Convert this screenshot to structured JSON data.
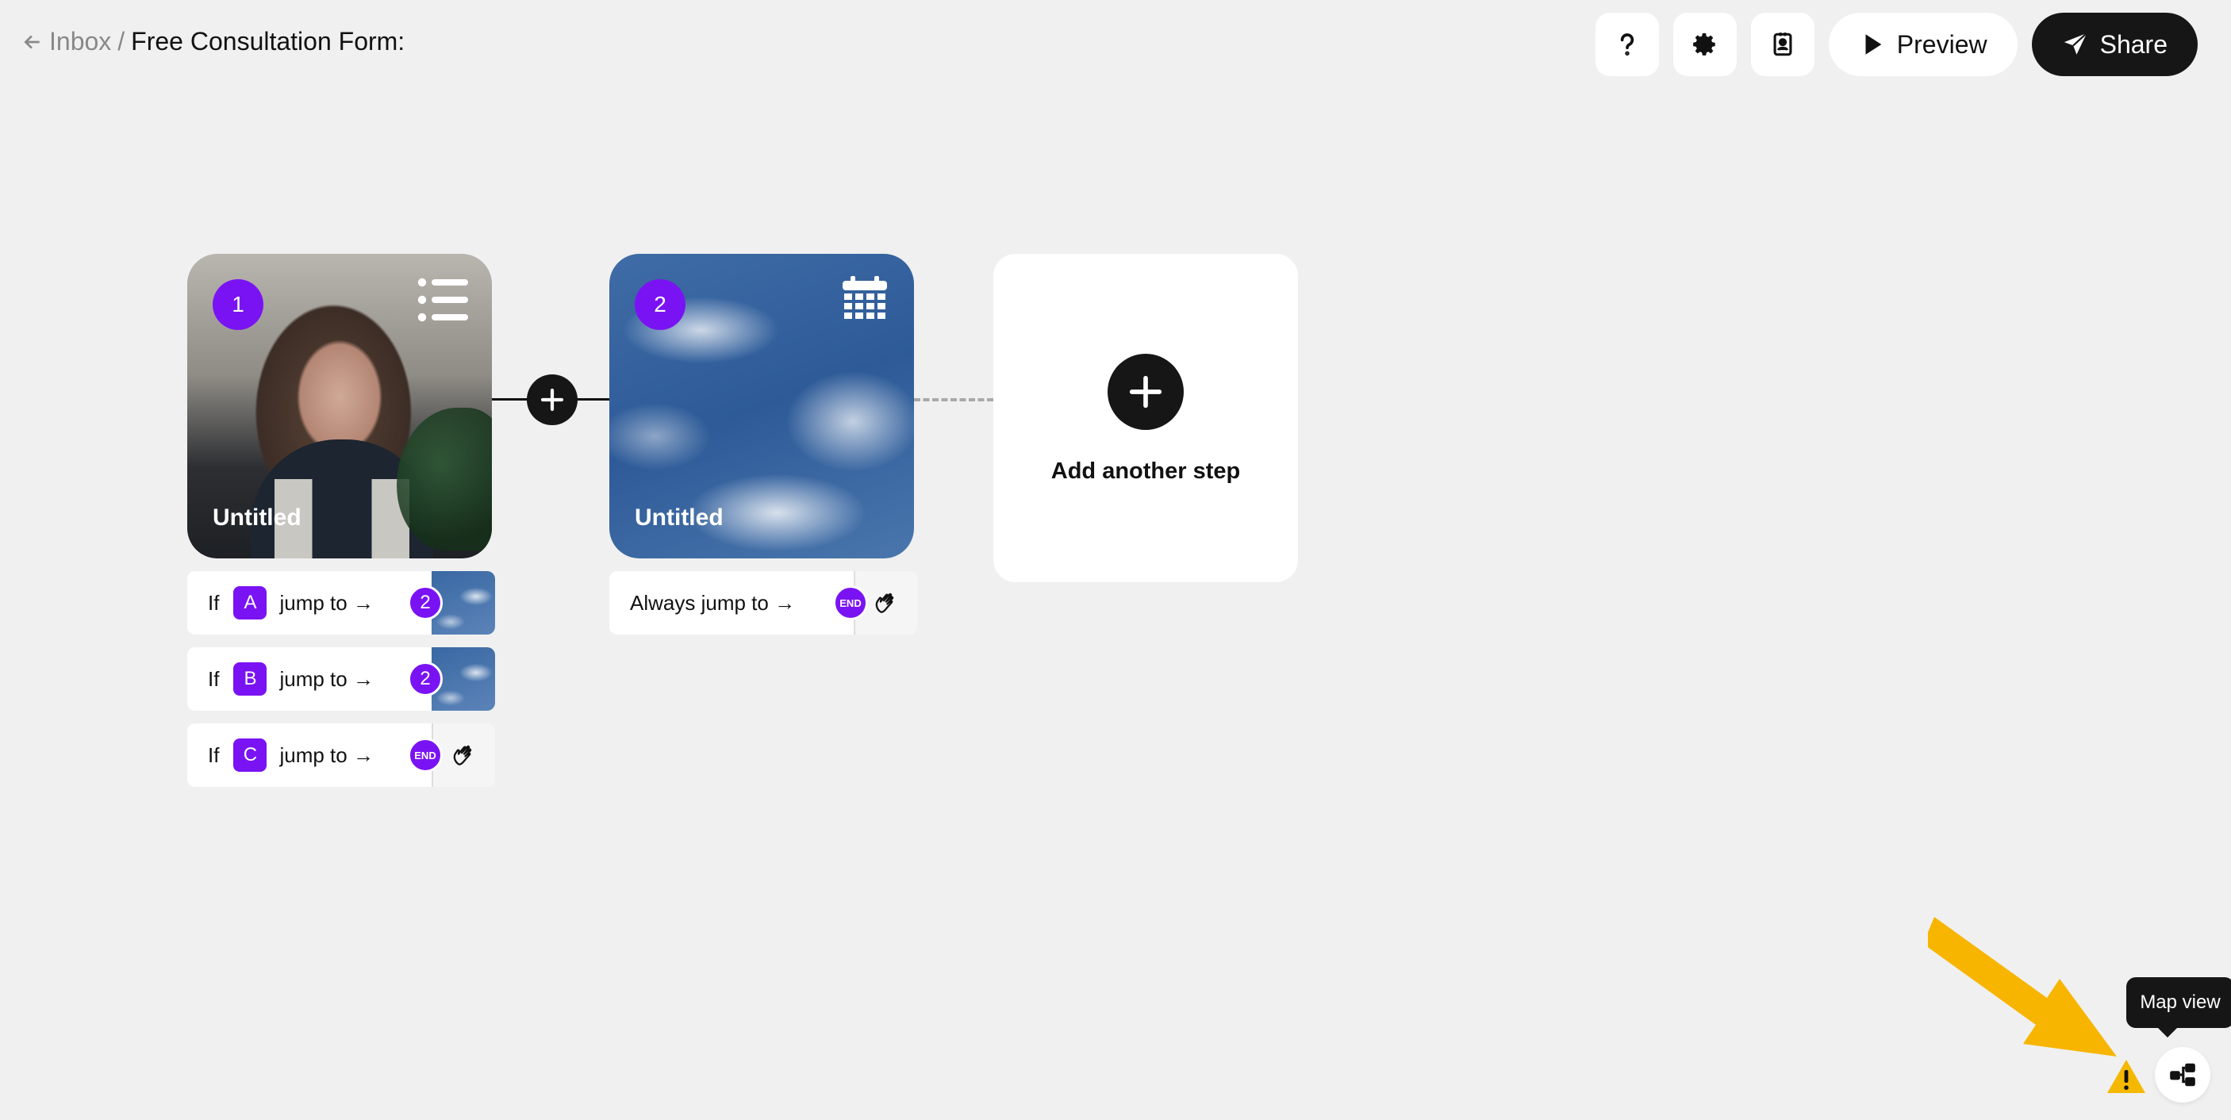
{
  "header": {
    "back_label": "Inbox",
    "separator": "/",
    "form_title": "Free Consultation Form:",
    "preview_label": "Preview",
    "share_label": "Share"
  },
  "steps": [
    {
      "number": "1",
      "title": "Untitled",
      "type_icon": "list-icon",
      "media": "video"
    },
    {
      "number": "2",
      "title": "Untitled",
      "type_icon": "calendar-icon",
      "media": "sky"
    }
  ],
  "add_step": {
    "label": "Add another step"
  },
  "rules_step1": [
    {
      "if": "If",
      "letter": "A",
      "jump": "jump to →",
      "target": "2"
    },
    {
      "if": "If",
      "letter": "B",
      "jump": "jump to →",
      "target": "2"
    },
    {
      "if": "If",
      "letter": "C",
      "jump": "jump to →",
      "target": "END"
    }
  ],
  "rules_step2": [
    {
      "jump": "Always jump to →",
      "target": "END"
    }
  ],
  "map_view": {
    "tooltip": "Map view"
  },
  "colors": {
    "accent": "#7a13f3",
    "dark": "#161616",
    "canvas": "#f0f0f0",
    "warning": "#f5b800"
  }
}
